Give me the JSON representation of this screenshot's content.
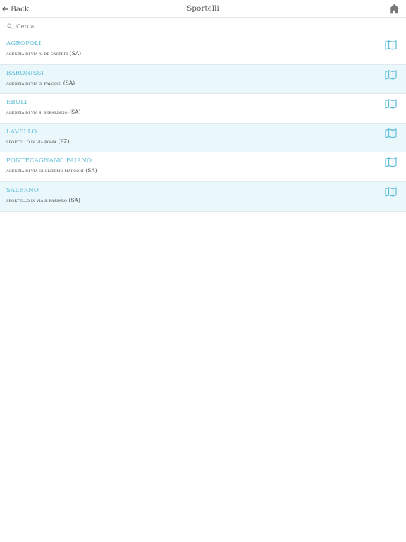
{
  "nav": {
    "back_label": "Back",
    "title": "Sportelli",
    "back_icon": "arrow-left-icon",
    "home_icon": "home-icon"
  },
  "search": {
    "placeholder": "Cerca",
    "value": "",
    "icon": "search-icon"
  },
  "branches": [
    {
      "name": "AGROPOLI",
      "address": "agenzia di via a. de gasperi",
      "province": "(SA)"
    },
    {
      "name": "BARONISSI",
      "address": "agenzia di via g. falconi",
      "province": "(SA)"
    },
    {
      "name": "EBOLI",
      "address": "agenzia di via s. berardino",
      "province": "(SA)"
    },
    {
      "name": "LAVELLO",
      "address": "sportello di via roma",
      "province": "(PZ)"
    },
    {
      "name": "PONTECAGNANO FAIANO",
      "address": "agenzia di via guglielmo marconi",
      "province": "(SA)"
    },
    {
      "name": "SALERNO",
      "address": "sportello di via s. passaro",
      "province": "(SA)"
    }
  ],
  "colors": {
    "accent": "#5bbcd6",
    "row_alt": "#eaf8fc",
    "icon_gray": "#666666"
  }
}
